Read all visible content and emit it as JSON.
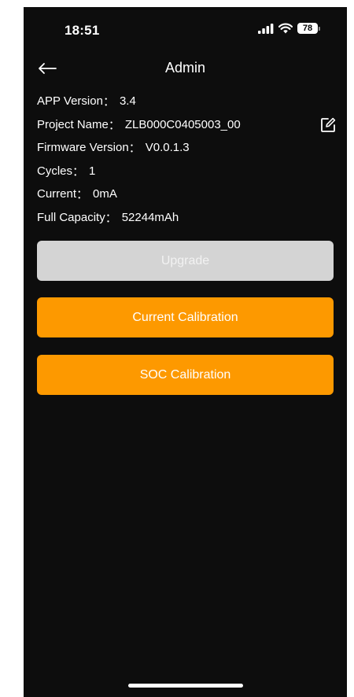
{
  "status_bar": {
    "time": "18:51",
    "battery_level": "78",
    "icons": [
      "signal-icon",
      "wifi-icon",
      "battery-icon"
    ]
  },
  "nav": {
    "title": "Admin",
    "back_icon": "arrow-left-icon"
  },
  "info": {
    "separator": "：",
    "app_version": {
      "label": "APP Version",
      "value": "3.4"
    },
    "project_name": {
      "label": "Project Name",
      "value": "ZLB000C0405003_00",
      "edit_icon": "edit-icon"
    },
    "firmware_version": {
      "label": "Firmware Version",
      "value": "V0.0.1.3"
    },
    "cycles": {
      "label": "Cycles",
      "value": "1"
    },
    "current": {
      "label": "Current",
      "value": "0mA"
    },
    "full_capacity": {
      "label": "Full Capacity",
      "value": "52244mAh"
    }
  },
  "buttons": {
    "upgrade": "Upgrade",
    "current_calibration": "Current Calibration",
    "soc_calibration": "SOC Calibration"
  },
  "colors": {
    "background": "#0d0d0d",
    "accent": "#fd9900",
    "disabled_button": "#d4d4d4",
    "text": "#ffffff"
  }
}
